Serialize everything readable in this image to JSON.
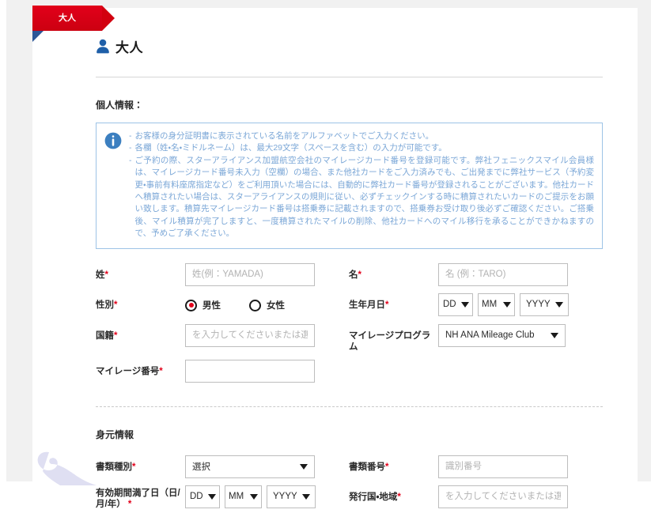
{
  "ribbon": {
    "label": "大人",
    "color": "#d60011",
    "fold_color": "#2c5697"
  },
  "header": {
    "icon": "person-icon",
    "title": "大人",
    "icon_color": "#1f5fa8"
  },
  "personal_section": {
    "heading": "個人情報：",
    "info_box": {
      "icon": "info-circle-icon",
      "icon_color": "#3c7fc0",
      "border_color": "#9dc3e6",
      "text_color": "#7ba7d7",
      "bullet": "-",
      "lines": [
        "お客様の身分証明書に表示されている名前をアルファベットでご入力ください。",
        "各欄（姓・名・ミドルネーム）は、最大29文字（スペースを含む）の入力が可能です。",
        "ご予約の際、スターアライアンス加盟航空会社のマイレージカード番号を登録可能です。弊社フェニックスマイル会員様は、マイレージカード番号未入力（空欄）の場合、また他社カードをご入力済みでも、ご出発までに弊社サービス（予約変更・事前有料座席指定など）をご利用頂いた場合には、自動的に弊社カード番号が登録されることがございます。他社カードへ積算されたい場合は、スターアライアンスの規則に従い、必ずチェックインする時に積算されたいカードのご提示をお願い致します。積算先マイレージカード番号は搭乗券に記載されますので、搭乗券お受け取り後必ずご確認ください。ご搭乗後、マイル積算が完了しますと、一度積算されたマイルの削除、他社カードへのマイル移行を承ることができかねますので、予めご了承ください。"
      ]
    },
    "fields": {
      "last_name": {
        "label": "姓",
        "required": "*",
        "placeholder_jp": "姓(例：",
        "placeholder_en": "YAMADA)",
        "value": ""
      },
      "first_name": {
        "label": "名",
        "required": "*",
        "placeholder_jp": "名 (例：",
        "placeholder_en": "TARO)",
        "value": ""
      },
      "gender": {
        "label": "性別",
        "required": "*",
        "options": [
          {
            "label": "男性",
            "selected": true
          },
          {
            "label": "女性",
            "selected": false
          }
        ],
        "selected_color": "#e2001a"
      },
      "birthdate": {
        "label": "生年月日",
        "required": "*",
        "day": "DD",
        "month": "MM",
        "year": "YYYY"
      },
      "nationality": {
        "label": "国籍",
        "required": "*",
        "placeholder": "を入力してくださいまたは選択",
        "value": ""
      },
      "mileage_program": {
        "label": "マイレージプログラム",
        "required": "",
        "value": "NH ANA Mileage Club"
      },
      "mileage_number": {
        "label": "マイレージ番号",
        "required": "*",
        "placeholder": "",
        "value": ""
      }
    }
  },
  "identity_section": {
    "heading": "身元情報",
    "fields": {
      "document_type": {
        "label": "書類種別",
        "required": "*",
        "value": "選択"
      },
      "document_number": {
        "label": "書類番号",
        "required": "*",
        "placeholder": "識別番号",
        "value": ""
      },
      "expiry_date": {
        "label": "有効期間満了日（日/月/年）",
        "required": "*",
        "day": "DD",
        "month": "MM",
        "year": "YYYY"
      },
      "issuing_country": {
        "label": "発行国・地域",
        "required": "*",
        "placeholder": "を入力してくださいまたは選択",
        "value": ""
      }
    }
  }
}
